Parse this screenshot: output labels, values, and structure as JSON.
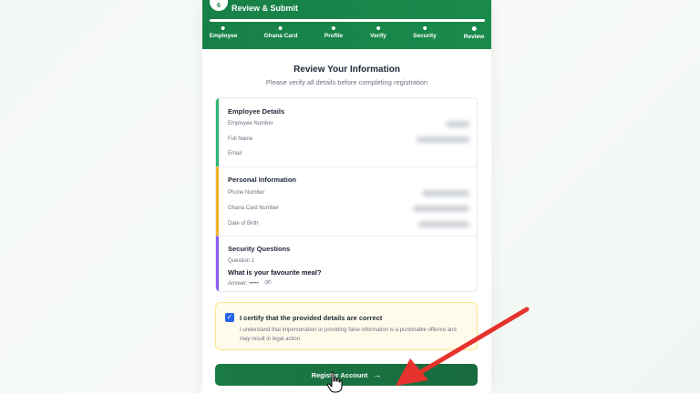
{
  "header": {
    "step_number": "6",
    "title": "Review & Submit",
    "progress_percent": 100,
    "steps": [
      {
        "label": "Employee"
      },
      {
        "label": "Ghana Card"
      },
      {
        "label": "Profile"
      },
      {
        "label": "Verify"
      },
      {
        "label": "Security"
      },
      {
        "label": "Review"
      }
    ]
  },
  "review": {
    "title": "Review Your Information",
    "subtitle": "Please verify all details before completing registration"
  },
  "sections": {
    "employee": {
      "title": "Employee Details",
      "accent": "#2bb673",
      "fields": [
        "Employee Number",
        "Full Name",
        "Email"
      ]
    },
    "personal": {
      "title": "Personal Information",
      "accent": "#f0b429",
      "fields": [
        "Phone Number",
        "Ghana Card Number",
        "Date of Birth"
      ]
    },
    "security": {
      "title": "Security Questions",
      "accent": "#8b5cf6",
      "question_label": "Question 1",
      "question": "What is your favourite meal?",
      "answer_label": "Answer: •••••",
      "answer_icon": "eye-off-icon"
    }
  },
  "certify": {
    "checked": true,
    "title": "I certify that the provided details are correct",
    "text": "I understand that impersonation or providing false information is a punishable offence and may result in legal action."
  },
  "register_button": {
    "label": "Register Account",
    "icon": "arrow-right-icon"
  },
  "colors": {
    "brand_green": "#178047",
    "annotation_red": "#e5322d"
  }
}
